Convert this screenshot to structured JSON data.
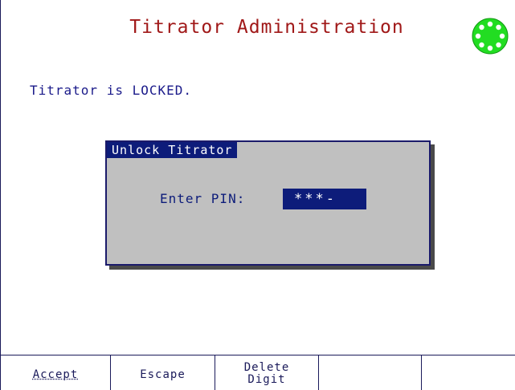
{
  "screen": {
    "title": "Titrator Administration",
    "status_icon": "status-indicator-icon",
    "status_icon_color": "#22dd22",
    "lock_status": "Titrator is LOCKED."
  },
  "dialog": {
    "title": "Unlock Titrator",
    "pin_label": "Enter PIN:",
    "pin_value": "***-"
  },
  "softkeys": [
    {
      "label": "Accept"
    },
    {
      "label": "Escape"
    },
    {
      "label": "Delete\nDigit"
    },
    {
      "label": ""
    },
    {
      "label": ""
    }
  ],
  "colors": {
    "title": "#a01818",
    "text": "#1a1a8a",
    "dialog_bg": "#c0c0c0",
    "dialog_accent": "#0d1c7a"
  }
}
